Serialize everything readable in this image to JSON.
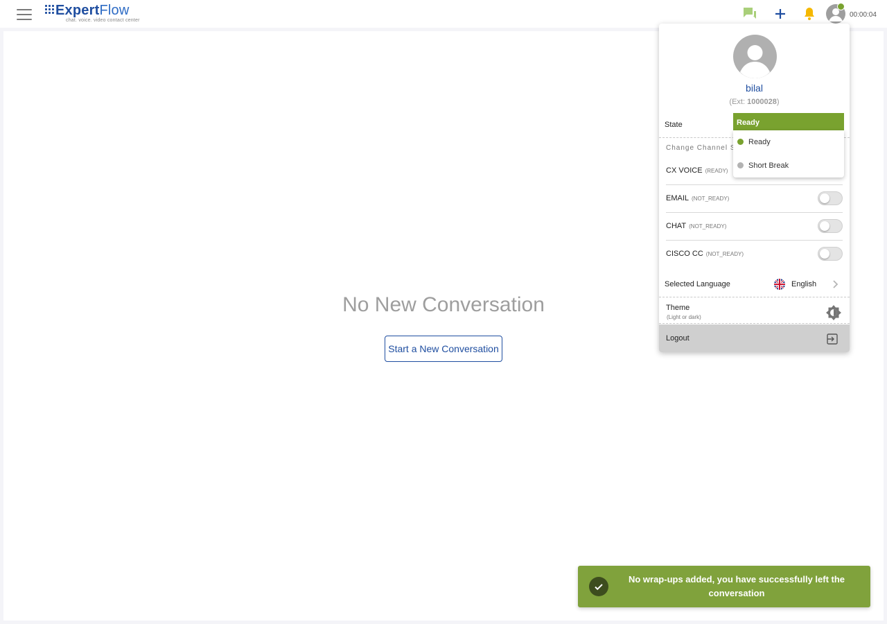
{
  "header": {
    "logo_primary": "Expert",
    "logo_secondary": "Flow",
    "logo_tagline": "chat. voice. video contact center",
    "timer": "00:00:04",
    "icons": [
      "menu-icon",
      "chat-bubbles-icon",
      "plus-icon",
      "bell-icon",
      "user-avatar-icon"
    ]
  },
  "main": {
    "empty_title": "No New Conversation",
    "start_button": "Start a New Conversation"
  },
  "profile": {
    "name": "bilal",
    "ext_prefix": "(Ext: ",
    "ext_number": "1000028",
    "ext_suffix": ")",
    "state_label": "State",
    "state_selected": "Ready",
    "state_options": [
      {
        "label": "Ready",
        "color": "#79a22f"
      },
      {
        "label": "Short Break",
        "color": "#b3b3b3"
      }
    ],
    "change_channel_label": "Change Channel S",
    "channels": [
      {
        "name": "CX VOICE",
        "status": "(READY)"
      },
      {
        "name": "EMAIL",
        "status": "(NOT_READY)"
      },
      {
        "name": "CHAT",
        "status": "(NOT_READY)"
      },
      {
        "name": "CISCO CC",
        "status": "(NOT_READY)"
      }
    ],
    "language_label": "Selected Language",
    "language_value": "English",
    "theme_label": "Theme",
    "theme_sub": "(Light or dark)",
    "logout_label": "Logout"
  },
  "toast": {
    "message": "No wrap-ups added, you have successfully left the conversation"
  },
  "colors": {
    "brand": "#1f4ea0",
    "ready_green": "#79a22f",
    "toast_green": "#80a23c",
    "bell": "#f5b800"
  }
}
